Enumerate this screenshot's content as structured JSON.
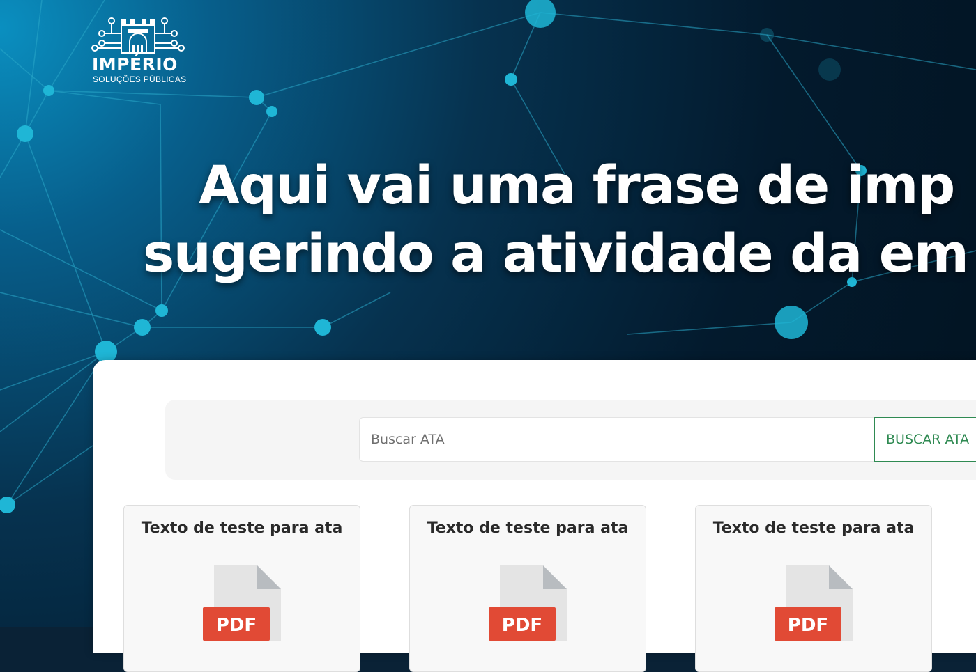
{
  "brand": {
    "name": "IMPÉRIO",
    "tagline": "SOLUÇÕES PÚBLICAS"
  },
  "hero": {
    "headline_line1": "Aqui vai uma frase de imp",
    "headline_line2": "sugerindo a atividade da em"
  },
  "search": {
    "placeholder": "Buscar ATA",
    "button_label": "BUSCAR ATA"
  },
  "cards": [
    {
      "title": "Texto de teste para ata",
      "icon": "pdf-file-icon",
      "badge": "PDF"
    },
    {
      "title": "Texto de teste para ata",
      "icon": "pdf-file-icon",
      "badge": "PDF"
    },
    {
      "title": "Texto de teste para ata",
      "icon": "pdf-file-icon",
      "badge": "PDF"
    }
  ],
  "colors": {
    "hero_background": "#031a2d",
    "network_accent": "#1fb6d6",
    "button_green": "#2f8a52",
    "pdf_red": "#e14a35"
  }
}
